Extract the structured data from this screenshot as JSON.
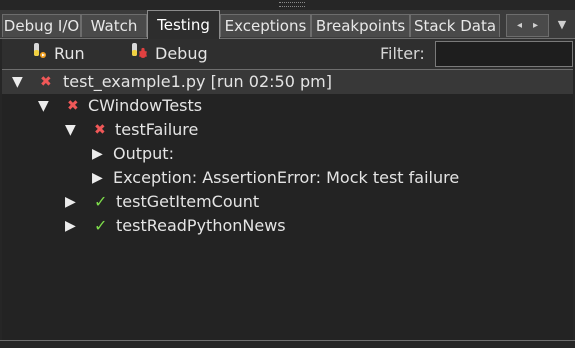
{
  "tabs": [
    {
      "label": "Debug I/O",
      "active": false
    },
    {
      "label": "Watch",
      "active": false
    },
    {
      "label": "Testing",
      "active": true
    },
    {
      "label": "Exceptions",
      "active": false
    },
    {
      "label": "Breakpoints",
      "active": false
    },
    {
      "label": "Stack Data",
      "active": false
    }
  ],
  "tab_nav": {
    "prev": "◂",
    "next": "▸",
    "menu": "▼"
  },
  "toolbar": {
    "run_label": "Run",
    "debug_label": "Debug",
    "filter_label": "Filter:",
    "filter_value": ""
  },
  "tree": [
    {
      "label": "test_example1.py [run 02:50 pm]",
      "expanded": true,
      "status": "fail",
      "level": 0,
      "selected": true
    },
    {
      "label": "CWindowTests",
      "expanded": true,
      "status": "fail",
      "level": 1
    },
    {
      "label": "testFailure",
      "expanded": true,
      "status": "fail",
      "level": 2
    },
    {
      "label": "Output:",
      "expanded": false,
      "status": "none",
      "level": 3
    },
    {
      "label": "Exception: AssertionError: Mock test failure",
      "expanded": false,
      "status": "none",
      "level": 3
    },
    {
      "label": "testGetItemCount",
      "expanded": false,
      "status": "pass",
      "level": 2
    },
    {
      "label": "testReadPythonNews",
      "expanded": false,
      "status": "pass",
      "level": 2
    }
  ],
  "glyphs": {
    "expanded": "▼",
    "collapsed": "▶",
    "fail": "✖",
    "pass": "✓"
  },
  "colors": {
    "fail": "#f05858",
    "pass": "#7ddc4a",
    "background": "#232323"
  }
}
